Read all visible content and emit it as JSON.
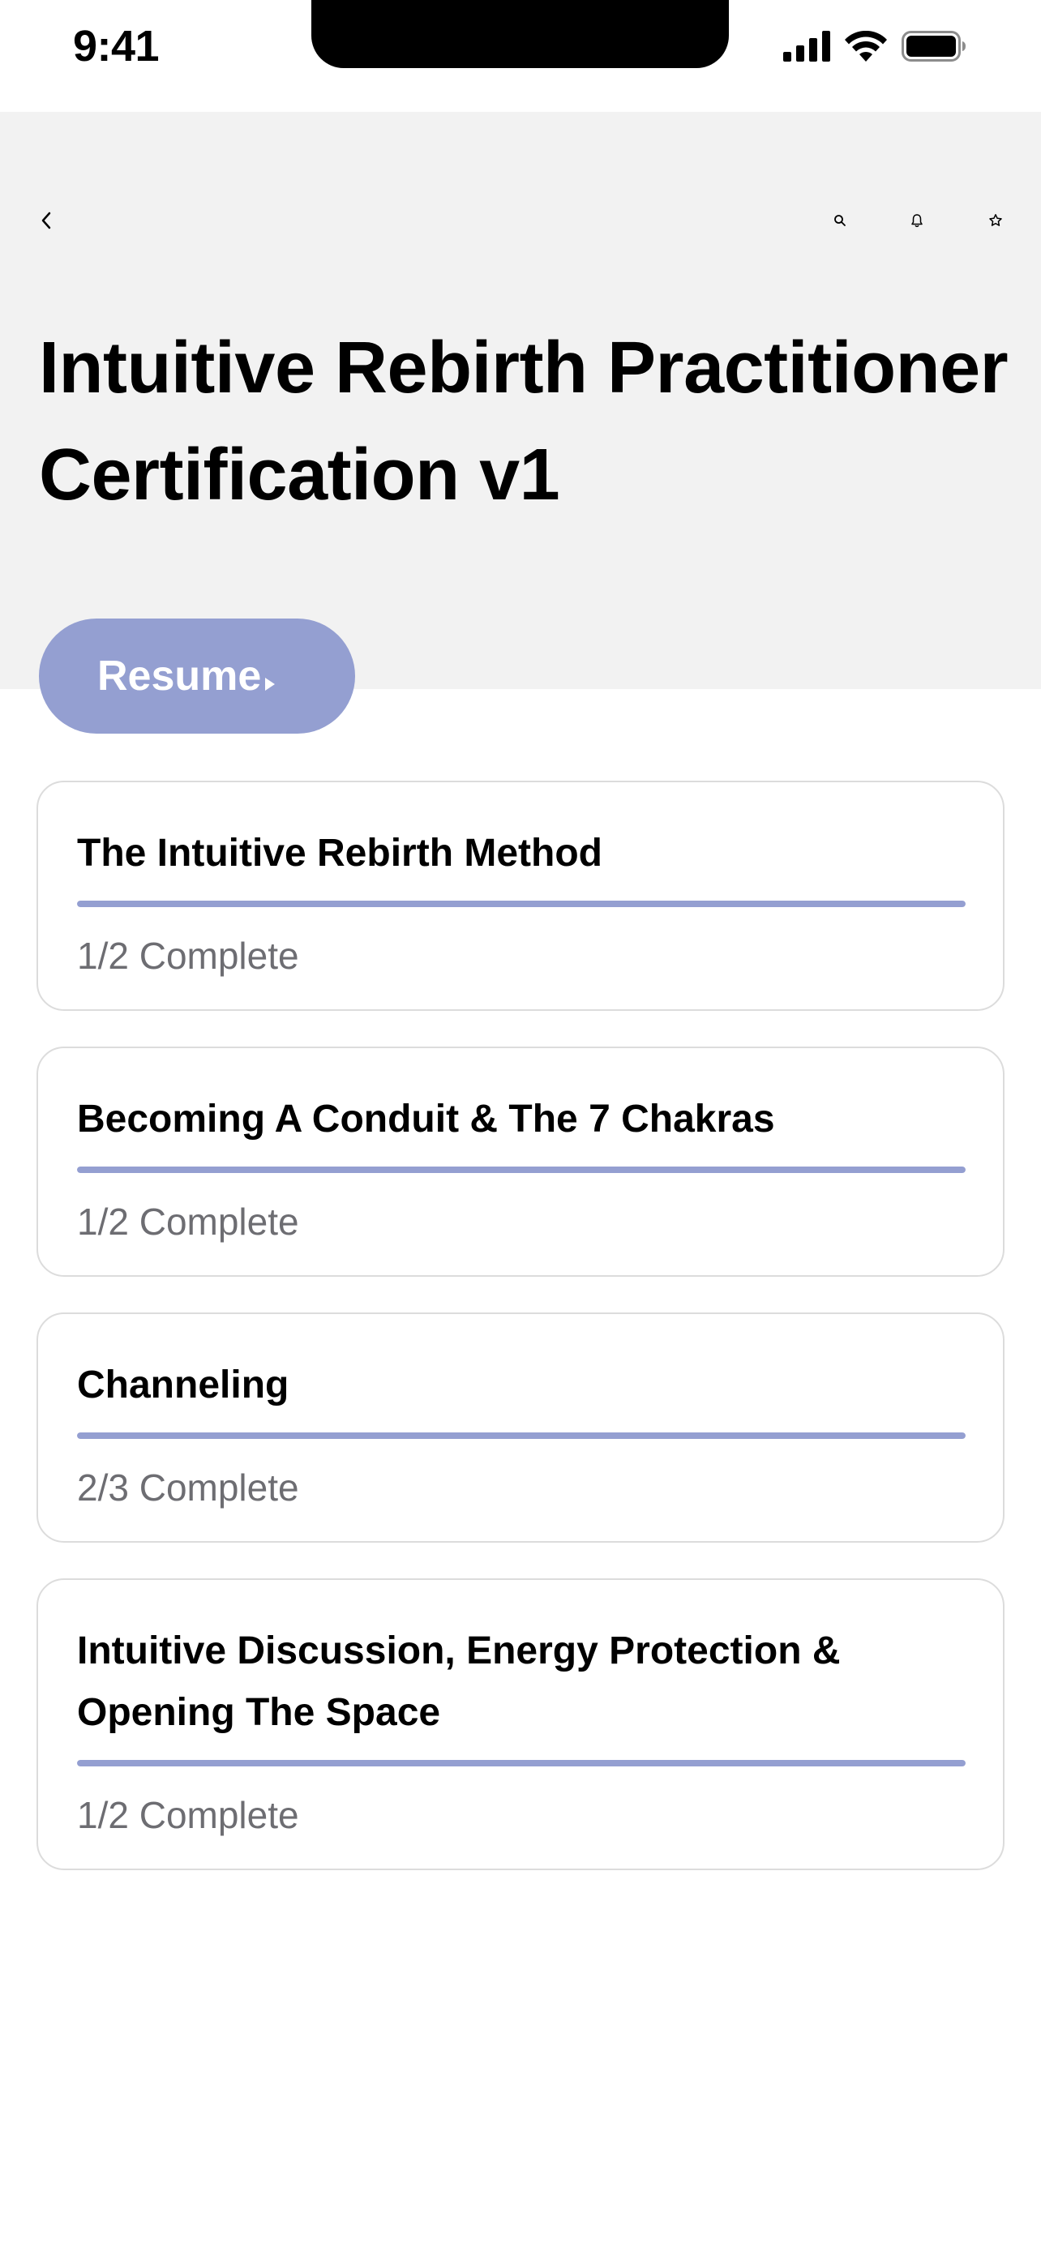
{
  "status_bar": {
    "time": "9:41"
  },
  "nav": {
    "back_icon": "chevron-left-icon",
    "actions": [
      "search-icon",
      "bell-icon",
      "star-icon"
    ]
  },
  "course": {
    "title": "Intuitive Rebirth Practitioner Certification v1"
  },
  "resume_button": {
    "label": "Resume",
    "icon": "play-icon",
    "color": "#949fd1"
  },
  "modules": [
    {
      "title": "The Intuitive Rebirth Method",
      "progress_text": "1/2 Complete",
      "progress": 1.0
    },
    {
      "title": "Becoming A Conduit & The 7 Chakras",
      "progress_text": "1/2 Complete",
      "progress": 1.0
    },
    {
      "title": "Channeling",
      "progress_text": "2/3 Complete",
      "progress": 1.0
    },
    {
      "title": "Intuitive Discussion, Energy Protection & Opening The Space",
      "progress_text": "1/2 Complete",
      "progress": 1.0
    }
  ],
  "colors": {
    "accent": "#949fd1",
    "header_background": "#f2f2f2",
    "muted_text": "#6d6d72"
  }
}
